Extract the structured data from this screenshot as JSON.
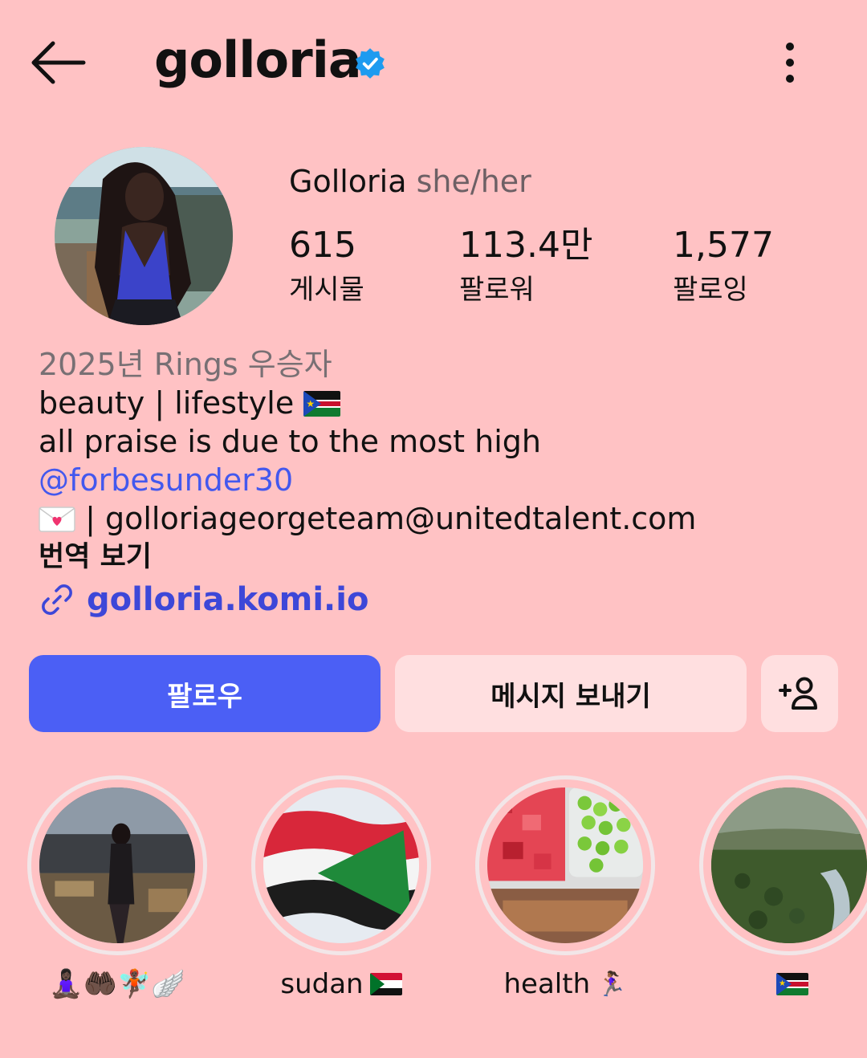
{
  "header": {
    "username": "golloria",
    "back_icon": "arrow-left-icon",
    "verified_icon": "verified-badge-icon",
    "more_icon": "more-vertical-icon"
  },
  "profile": {
    "display_name": "Golloria",
    "pronouns": "she/her",
    "stats": [
      {
        "value": "615",
        "label": "게시물"
      },
      {
        "value": "113.4만",
        "label": "팔로워"
      },
      {
        "value": "1,577",
        "label": "팔로잉"
      }
    ]
  },
  "bio": {
    "rings": "2025년 Rings 우승자",
    "line1": "beauty | lifestyle",
    "line2": "all praise is due to the most high",
    "mention": "@forbesunder30",
    "email_line": "| golloriageorgeteam@unitedtalent.com",
    "translate": "번역 보기",
    "link": "golloria.komi.io"
  },
  "actions": {
    "follow": "팔로우",
    "message": "메시지 보내기",
    "suggest_icon": "add-person-icon"
  },
  "highlights": [
    {
      "label": "🧘🏿‍♀️🤲🏿🧚🏿🪽"
    },
    {
      "label": "sudan"
    },
    {
      "label": "health"
    },
    {
      "label": ""
    }
  ],
  "colors": {
    "background": "#ffc2c4",
    "follow_button": "#4b5ff5",
    "secondary_button": "#ffdfe0",
    "mention": "#4358ee",
    "verified": "#1d9bf0"
  }
}
